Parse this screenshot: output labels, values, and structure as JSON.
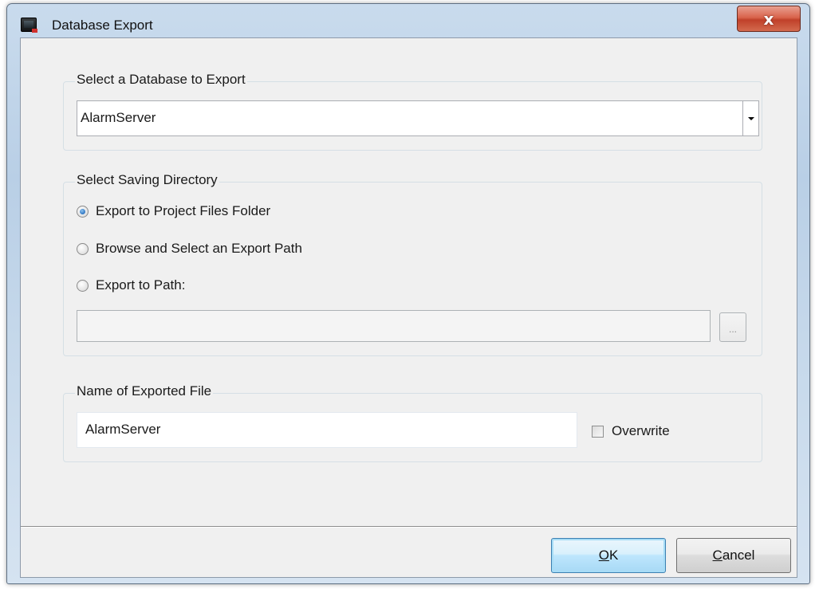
{
  "window": {
    "title": "Database Export",
    "close_label": "x"
  },
  "database_group": {
    "label": "Select a Database to Export",
    "selected_value": "AlarmServer"
  },
  "directory_group": {
    "label": "Select Saving Directory",
    "options": [
      {
        "label": "Export to Project Files Folder",
        "checked": true
      },
      {
        "label": "Browse and Select an Export Path",
        "checked": false
      },
      {
        "label": "Export to Path:",
        "checked": false
      }
    ],
    "path_value": "",
    "browse_label": "..."
  },
  "file_group": {
    "label": "Name of Exported File",
    "file_name": "AlarmServer",
    "overwrite_label": "Overwrite",
    "overwrite_checked": false
  },
  "buttons": {
    "ok_mnemonic": "O",
    "ok_rest": "K",
    "cancel_mnemonic": "C",
    "cancel_rest": "ancel"
  },
  "colors": {
    "accent": "#3c7fb1",
    "title_bar": "#c4d7ea",
    "close_button": "#c0412a",
    "dialog_background": "#f0f0f0"
  }
}
